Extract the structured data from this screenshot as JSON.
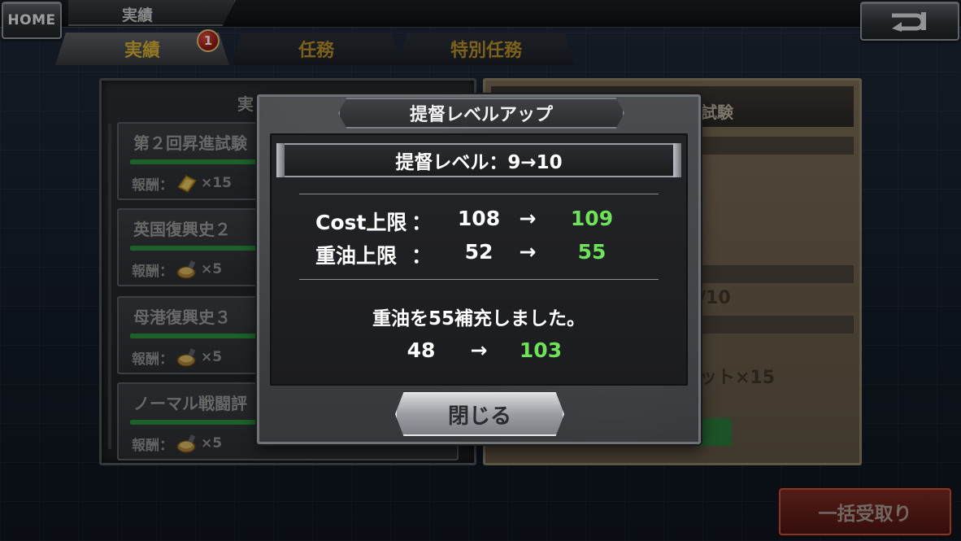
{
  "header": {
    "home_label": "HOME",
    "page_title": "実績",
    "back_icon": "return-arrow-icon"
  },
  "tabs": [
    {
      "label": "実績",
      "active": true
    },
    {
      "label": "任務",
      "active": false
    },
    {
      "label": "特別任務",
      "active": false
    }
  ],
  "tab_badge": "1",
  "list": {
    "header": "実",
    "reward_prefix": "報酬：",
    "items": [
      {
        "title": "第２回昇進試験",
        "reward_icon": "gold-ticket-icon",
        "reward_amount": "×15"
      },
      {
        "title": "英国復興史２",
        "reward_icon": "fuel-coin-icon",
        "reward_amount": "×5"
      },
      {
        "title": "母港復興史３",
        "reward_icon": "fuel-coin-icon",
        "reward_amount": "×5"
      },
      {
        "title": "ノーマル戦闘評",
        "reward_icon": "fuel-coin-icon",
        "reward_amount": "×5"
      }
    ]
  },
  "detail": {
    "title": "試験",
    "progress_text": "/10",
    "reward_text": "ット×15"
  },
  "bulk_receive_label": "一括受取り",
  "modal": {
    "title": "提督レベルアップ",
    "level_text": "提督レベル：9→10",
    "stats": [
      {
        "label": "Cost上限",
        "colon": "：",
        "old": "108",
        "arrow": "→",
        "new": "109"
      },
      {
        "label": "重油上限",
        "colon": "：",
        "old": "52",
        "arrow": "→",
        "new": "55"
      }
    ],
    "refill_message": "重油を55補充しました。",
    "refill": {
      "old": "48",
      "arrow": "→",
      "new": "103"
    },
    "close_label": "閉じる"
  },
  "colors": {
    "gain_green": "#6fe25a",
    "tab_gold": "#d9b035",
    "badge_red": "#b8201a"
  }
}
